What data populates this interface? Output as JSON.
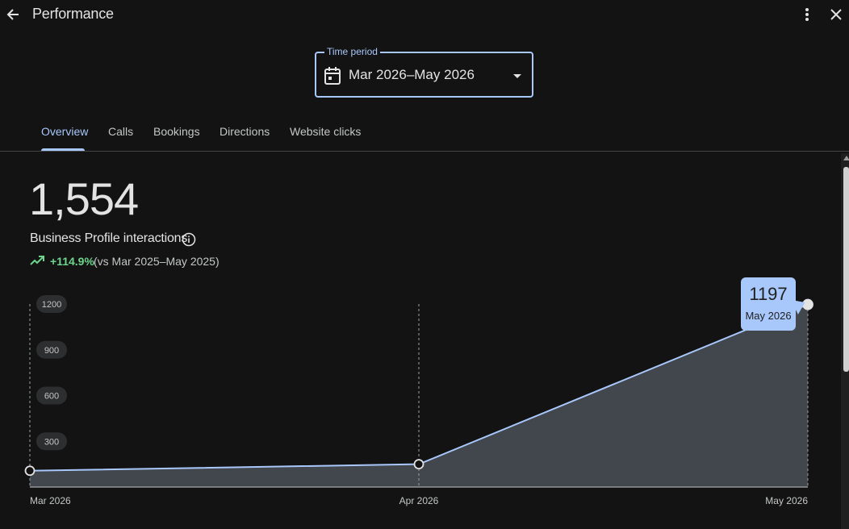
{
  "header": {
    "title": "Performance",
    "icons": {
      "back": "back-arrow-icon",
      "more": "more-vert-icon",
      "close": "close-icon"
    }
  },
  "time_period": {
    "legend": "Time period",
    "value": "Mar 2026–May 2026",
    "icon": "calendar-icon"
  },
  "tabs": [
    {
      "label": "Overview",
      "active": true
    },
    {
      "label": "Calls",
      "active": false
    },
    {
      "label": "Bookings",
      "active": false
    },
    {
      "label": "Directions",
      "active": false
    },
    {
      "label": "Website clicks",
      "active": false
    }
  ],
  "summary": {
    "total": "1,554",
    "label": "Business Profile interactions",
    "change": "+114.9%",
    "comparison": "(vs Mar 2025–May 2025)"
  },
  "tooltip": {
    "value": "1197",
    "label": "May 2026"
  },
  "colors": {
    "accent": "#a8c7fa",
    "positive": "#6dd58c",
    "background": "#131314",
    "area_fill": "#454950"
  },
  "chart_data": {
    "type": "area",
    "categories": [
      "Mar 2026",
      "Apr 2026",
      "May 2026"
    ],
    "series": [
      {
        "values": [
          107,
          150,
          1197
        ]
      }
    ],
    "y_ticks": [
      "300",
      "600",
      "900",
      "1200"
    ],
    "ylim": [
      0,
      1200
    ],
    "grid": "vertical-dashed",
    "highlight_index": 2
  }
}
